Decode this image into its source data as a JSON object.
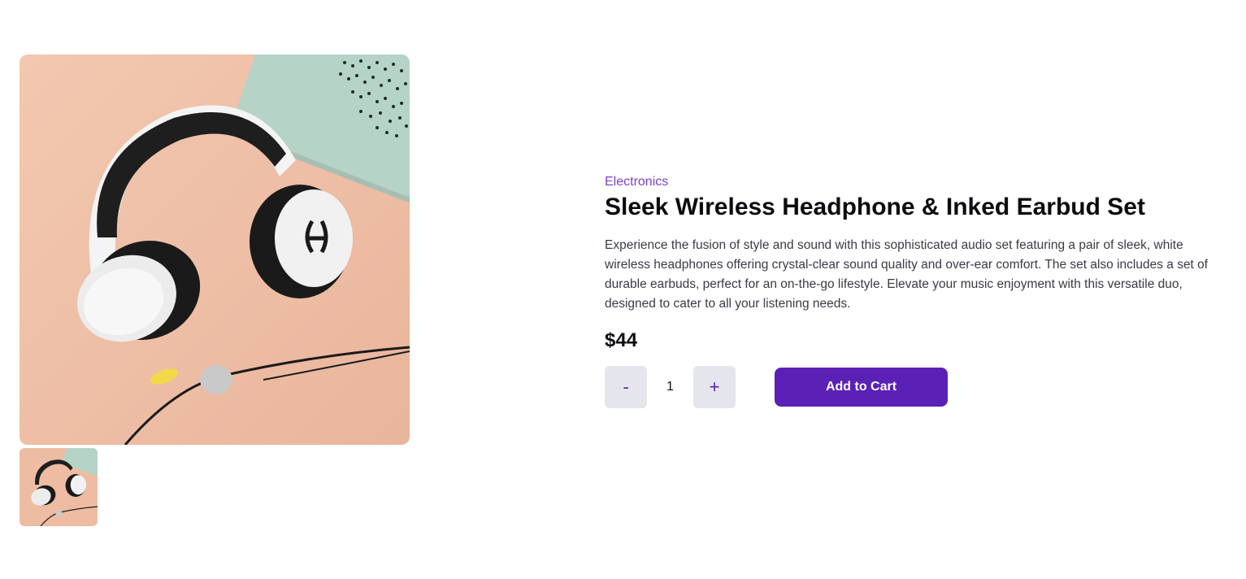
{
  "product": {
    "category": "Electronics",
    "title": "Sleek Wireless Headphone & Inked Earbud Set",
    "description": "Experience the fusion of style and sound with this sophisticated audio set featuring a pair of sleek, white wireless headphones offering crystal-clear sound quality and over-ear comfort. The set also includes a set of durable earbuds, perfect for an on-the-go lifestyle. Elevate your music enjoyment with this versatile duo, designed to cater to all your listening needs.",
    "price": "$44"
  },
  "quantity": {
    "decrement_label": "-",
    "value": "1",
    "increment_label": "+"
  },
  "cart": {
    "add_label": "Add to Cart"
  },
  "colors": {
    "accent": "#5b21b6",
    "category": "#7c3fcf",
    "background": "#f0c3aa",
    "device": "#b5d3c6"
  },
  "gallery": {
    "main_image_icon": "headphones-photo",
    "thumbnails": [
      "headphones-photo-thumbnail"
    ]
  }
}
